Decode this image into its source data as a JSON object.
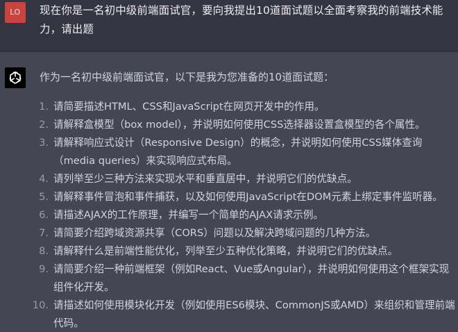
{
  "user": {
    "avatar_initials": "LO",
    "avatar_color": "#c9443e",
    "message": "现在你是一名初中级前端面试官，要向我提出10道面试题以全面考察我的前端技术能力，请出题"
  },
  "assistant": {
    "avatar_icon": "openai-logo-icon",
    "intro": "作为一名初中级前端面试官，以下是我为您准备的10道面试题：",
    "questions": [
      {
        "num": "1.",
        "text": "请简要描述HTML、CSS和JavaScript在网页开发中的作用。"
      },
      {
        "num": "2.",
        "text": "请解释盒模型（box model），并说明如何使用CSS选择器设置盒模型的各个属性。"
      },
      {
        "num": "3.",
        "text": "请解释响应式设计（Responsive Design）的概念，并说明如何使用CSS媒体查询（media queries）来实现响应式布局。"
      },
      {
        "num": "4.",
        "text": "请列举至少三种方法来实现水平和垂直居中，并说明它们的优缺点。"
      },
      {
        "num": "5.",
        "text": "请解释事件冒泡和事件捕获，以及如何使用JavaScript在DOM元素上绑定事件监听器。"
      },
      {
        "num": "6.",
        "text": "请描述AJAX的工作原理，并编写一个简单的AJAX请求示例。"
      },
      {
        "num": "7.",
        "text": "请简要介绍跨域资源共享（CORS）问题以及解决跨域问题的几种方法。"
      },
      {
        "num": "8.",
        "text": "请解释什么是前端性能优化，列举至少五种优化策略，并说明它们的优缺点。"
      },
      {
        "num": "9.",
        "text": "请简要介绍一种前端框架（例如React、Vue或Angular），并说明如何使用这个框架实现组件化开发。"
      },
      {
        "num": "10.",
        "text": "请描述如何使用模块化开发（例如使用ES6模块、CommonJS或AMD）来组织和管理前端代码。"
      }
    ]
  }
}
